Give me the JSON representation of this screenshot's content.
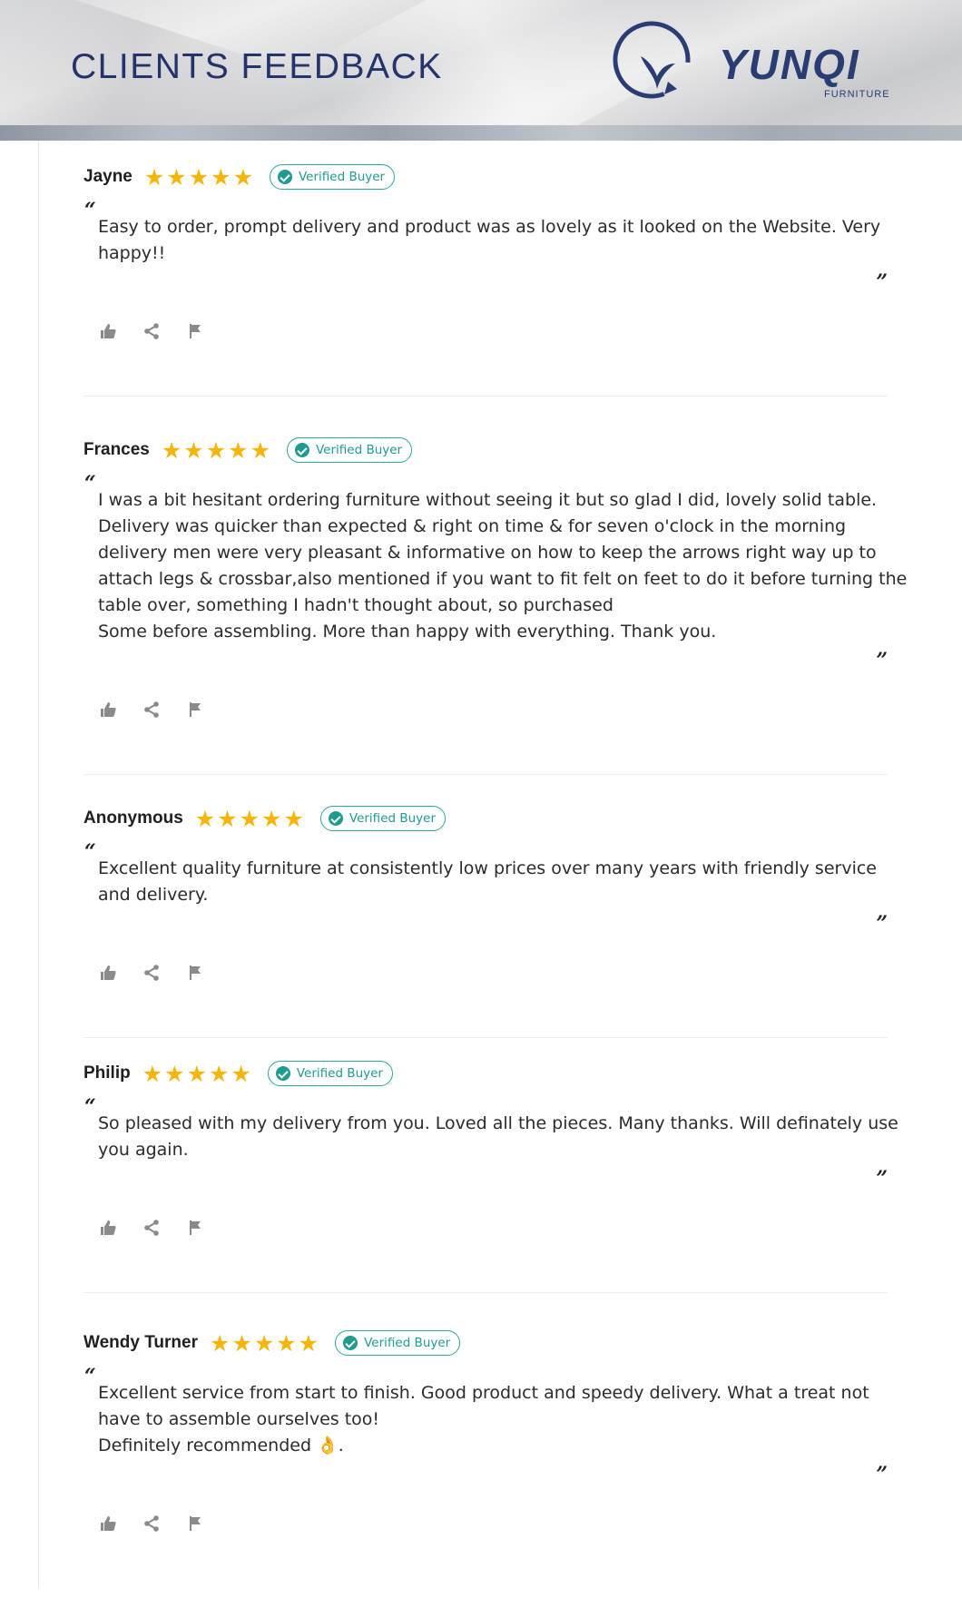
{
  "header": {
    "title": "CLIENTS FEEDBACK",
    "brand": "YUNQI",
    "brand_sub": "FURNITURE"
  },
  "colors": {
    "star": "#f5b50a",
    "badge": "#1f9b8f",
    "title": "#24336b"
  },
  "icons": {
    "badge": "check-circle-icon",
    "like": "thumbs-up-icon",
    "share": "share-icon",
    "flag": "flag-icon"
  },
  "reviews": [
    {
      "name": "Jayne",
      "rating": 5,
      "badge": "Verified Buyer",
      "lines": [
        "Easy to order, prompt delivery and product was as lovely as it looked on the Website.  Very",
        "happy!!"
      ]
    },
    {
      "name": "Frances",
      "rating": 5,
      "badge": "Verified Buyer",
      "lines": [
        "I was a bit hesitant ordering furniture without seeing it but so glad I did, lovely solid table.",
        "Delivery was quicker than expected & right on time & for seven o'clock in the morning",
        "delivery men were very pleasant & informative on how to keep the arrows right way up to",
        "attach legs & crossbar,also mentioned if you want to fit felt on feet to do it before turning the",
        "table over, something I hadn't thought about, so purchased",
        "Some before assembling. More than happy with everything. Thank you."
      ]
    },
    {
      "name": "Anonymous",
      "rating": 5,
      "badge": "Verified Buyer",
      "lines": [
        "Excellent quality furniture at consistently low prices over many years with friendly service",
        "and delivery."
      ]
    },
    {
      "name": "Philip",
      "rating": 5,
      "badge": "Verified Buyer",
      "lines": [
        "So pleased with my delivery from you. Loved all the pieces. Many thanks. Will definately use",
        "you again."
      ]
    },
    {
      "name": "Wendy Turner",
      "rating": 5,
      "badge": "Verified Buyer",
      "lines": [
        "Excellent service from start to finish. Good product and speedy delivery. What a treat not",
        "have to assemble ourselves too!",
        "Definitely recommended 👌."
      ]
    }
  ]
}
